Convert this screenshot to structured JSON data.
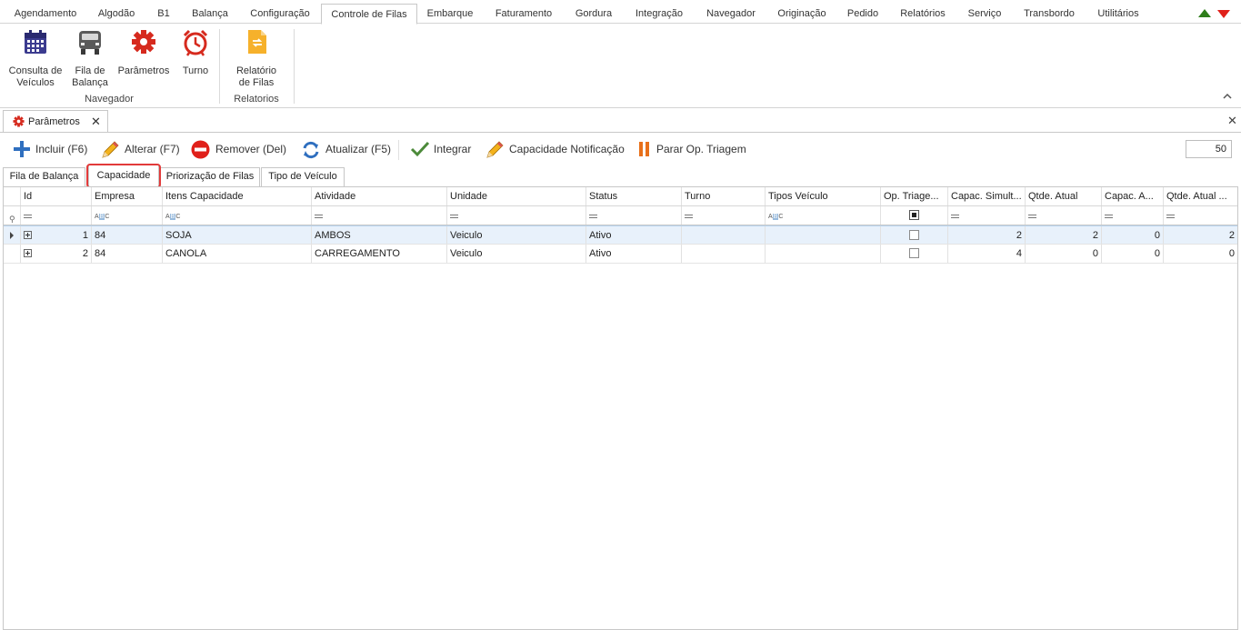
{
  "menu": {
    "tabs": [
      "Agendamento",
      "Algodão",
      "B1",
      "Balança",
      "Configuração",
      "Controle de Filas",
      "Embarque",
      "Faturamento",
      "Gordura",
      "Integração",
      "Navegador",
      "Originação",
      "Pedido",
      "Relatórios",
      "Serviço",
      "Transbordo",
      "Utilitários"
    ],
    "active": "Controle de Filas"
  },
  "ribbon": {
    "groups": [
      {
        "label": "Navegador",
        "buttons": [
          {
            "label": "Consulta de\nVeículos",
            "icon": "calendar-icon"
          },
          {
            "label": "Fila de\nBalança",
            "icon": "truck-icon"
          },
          {
            "label": "Parâmetros",
            "icon": "gear-icon"
          },
          {
            "label": "Turno",
            "icon": "alarm-clock-icon"
          }
        ]
      },
      {
        "label": "Relatorios",
        "buttons": [
          {
            "label": "Relatório\nde Filas",
            "icon": "report-icon"
          }
        ]
      }
    ]
  },
  "document": {
    "tab_label": "Parâmetros",
    "tab_icon": "gear-icon"
  },
  "toolbar": {
    "incluir": "Incluir (F6)",
    "alterar": "Alterar (F7)",
    "remover": "Remover (Del)",
    "atualizar": "Atualizar (F5)",
    "integrar": "Integrar",
    "capacidade_notificacao": "Capacidade Notificação",
    "parar": "Parar Op. Triagem",
    "page_size": "50"
  },
  "inner_tabs": [
    "Fila de Balança",
    "Capacidade",
    "Priorização de Filas",
    "Tipo de Veículo"
  ],
  "active_inner_tab": "Capacidade",
  "grid": {
    "columns": [
      "Id",
      "Empresa",
      "Itens Capacidade",
      "Atividade",
      "Unidade",
      "Status",
      "Turno",
      "Tipos Veículo",
      "Op. Triage...",
      "Capac. Simult...",
      "Qtde. Atual",
      "Capac. A...",
      "Qtde. Atual ..."
    ],
    "rows": [
      {
        "id": "1",
        "empresa": "84",
        "itens": "SOJA",
        "atividade": "AMBOS",
        "unidade": "Veiculo",
        "status": "Ativo",
        "turno": "",
        "tipos": "",
        "op_triagem": false,
        "capac_simult": "2",
        "qtde_atual": "2",
        "capac_a": "0",
        "qtde_atual2": "2"
      },
      {
        "id": "2",
        "empresa": "84",
        "itens": "CANOLA",
        "atividade": "CARREGAMENTO",
        "unidade": "Veiculo",
        "status": "Ativo",
        "turno": "",
        "tipos": "",
        "op_triagem": false,
        "capac_simult": "4",
        "qtde_atual": "0",
        "capac_a": "0",
        "qtde_atual2": "0"
      }
    ]
  },
  "colors": {
    "highlight": "#e23a3a",
    "selected_row": "#e8f1fb",
    "add": "#2f6fbf",
    "remove": "#e0201a",
    "integrate": "#4c8a3a",
    "stop": "#e8701a"
  }
}
